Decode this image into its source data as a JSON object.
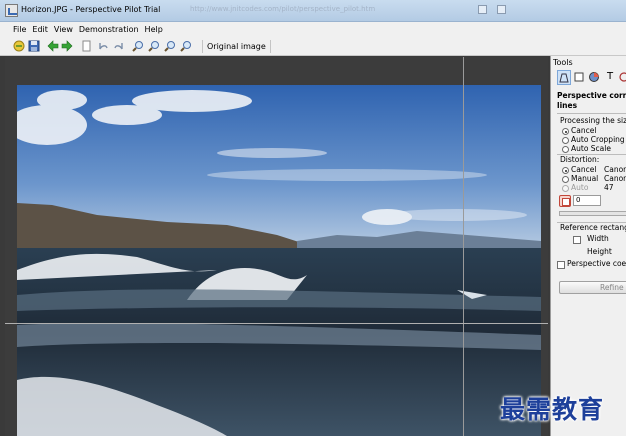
{
  "window": {
    "title": "Horizon.JPG - Perspective Pilot Trial",
    "background_url_text": "http://www.jnitcodes.com/pilot/perspective_pilot.htm"
  },
  "menu": [
    "File",
    "Edit",
    "View",
    "Demonstration",
    "Help"
  ],
  "toolbar": {
    "icons": [
      "open-icon",
      "save-icon",
      "back-arrow-icon",
      "forward-arrow-icon",
      "page-icon",
      "undo-icon",
      "redo-icon",
      "zoom-in-icon",
      "zoom-out-icon",
      "zoom-fit-icon",
      "zoom-actual-icon"
    ],
    "original_image_label": "Original image"
  },
  "tools": {
    "header": "Tools",
    "section_title_1": "Perspective correct",
    "section_title_2": "lines",
    "processing_size": {
      "label": "Processing the size:",
      "options": [
        "Cancel",
        "Auto Cropping",
        "Auto Scale"
      ],
      "selected": "Cancel"
    },
    "distortion": {
      "label": "Distortion:",
      "options": [
        "Cancel",
        "Manual",
        "Auto"
      ],
      "selected": "Cancel",
      "lens_1": "Canon",
      "lens_2": "Canon",
      "lens_3": "47",
      "value": "0"
    },
    "reference_rectangle": {
      "label": "Reference rectangle",
      "width_label": "Width",
      "height_label": "Height"
    },
    "perspective_coeff_label": "Perspective coeffi",
    "refine_button": "Refine"
  },
  "watermark": "最需教育",
  "colors": {
    "titlebar": "#b9d0e8",
    "accent_green": "#36a336",
    "selected_tab": "#cfe2f7",
    "highlight_red": "#c2473a",
    "watermark_blue": "#1d3f9a"
  }
}
